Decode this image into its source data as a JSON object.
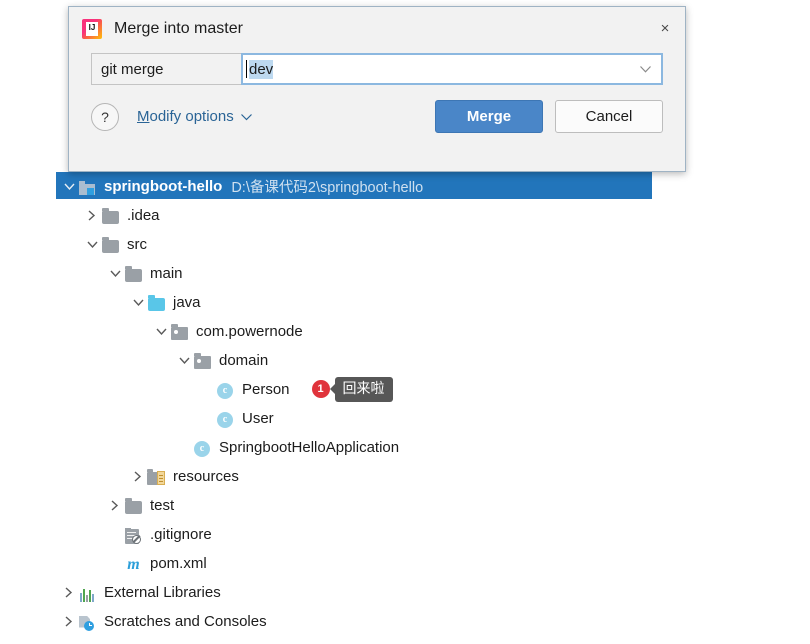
{
  "dialog": {
    "icon": "intellij-idea-logo",
    "title": "Merge into master",
    "close_label": "×",
    "command_label": "git merge",
    "branch_value": "dev",
    "branch_placeholder": "",
    "dropdown_icon": "chevron-down-icon",
    "help_label": "?",
    "modify_options_mnemonic": "M",
    "modify_options_rest": "odify options",
    "modify_options_chevron": "⌄",
    "merge_button": "Merge",
    "cancel_button": "Cancel",
    "colors": {
      "primary_button": "#4a86c8",
      "focus_border": "#8cb8e0",
      "selection": "#bdd9f0",
      "link": "#2a6496"
    }
  },
  "tree": {
    "selection_color": "#2275bb",
    "badge_color": "#e0343c",
    "tooltip_bg": "#575757",
    "nodes": [
      {
        "label": "springboot-hello",
        "path": "D:\\备课代码2\\springboot-hello",
        "icon": "module-icon",
        "arrow": "expanded",
        "indent": 0,
        "selected": true,
        "bold": true
      },
      {
        "label": ".idea",
        "icon": "folder-icon",
        "arrow": "collapsed",
        "indent": 1,
        "selected": false,
        "bold": false
      },
      {
        "label": "src",
        "icon": "folder-icon",
        "arrow": "expanded",
        "indent": 1,
        "selected": false,
        "bold": false
      },
      {
        "label": "main",
        "icon": "folder-icon",
        "arrow": "expanded",
        "indent": 2,
        "selected": false,
        "bold": false
      },
      {
        "label": "java",
        "icon": "source-folder-icon",
        "arrow": "expanded",
        "indent": 3,
        "selected": false,
        "bold": false
      },
      {
        "label": "com.powernode",
        "icon": "package-icon",
        "arrow": "expanded",
        "indent": 4,
        "selected": false,
        "bold": false
      },
      {
        "label": "domain",
        "icon": "package-icon",
        "arrow": "expanded",
        "indent": 5,
        "selected": false,
        "bold": false
      },
      {
        "label": "Person",
        "icon": "java-class-icon",
        "arrow": "none",
        "indent": 6,
        "selected": false,
        "bold": false,
        "badge": "1",
        "tooltip": "回来啦"
      },
      {
        "label": "User",
        "icon": "java-class-icon",
        "arrow": "none",
        "indent": 6,
        "selected": false,
        "bold": false
      },
      {
        "label": "SpringbootHelloApplication",
        "icon": "java-class-icon",
        "arrow": "none",
        "indent": 5,
        "selected": false,
        "bold": false
      },
      {
        "label": "resources",
        "icon": "resources-folder-icon",
        "arrow": "collapsed",
        "indent": 3,
        "selected": false,
        "bold": false
      },
      {
        "label": "test",
        "icon": "folder-icon",
        "arrow": "collapsed",
        "indent": 2,
        "selected": false,
        "bold": false
      },
      {
        "label": ".gitignore",
        "icon": "gitignore-icon",
        "arrow": "none",
        "indent": 2,
        "selected": false,
        "bold": false
      },
      {
        "label": "pom.xml",
        "icon": "maven-icon",
        "arrow": "none",
        "indent": 2,
        "selected": false,
        "bold": false
      },
      {
        "label": "External Libraries",
        "icon": "library-icon",
        "arrow": "collapsed",
        "indent": 0,
        "selected": false,
        "bold": false
      },
      {
        "label": "Scratches and Consoles",
        "icon": "scratches-icon",
        "arrow": "collapsed",
        "indent": 0,
        "selected": false,
        "bold": false
      }
    ]
  }
}
